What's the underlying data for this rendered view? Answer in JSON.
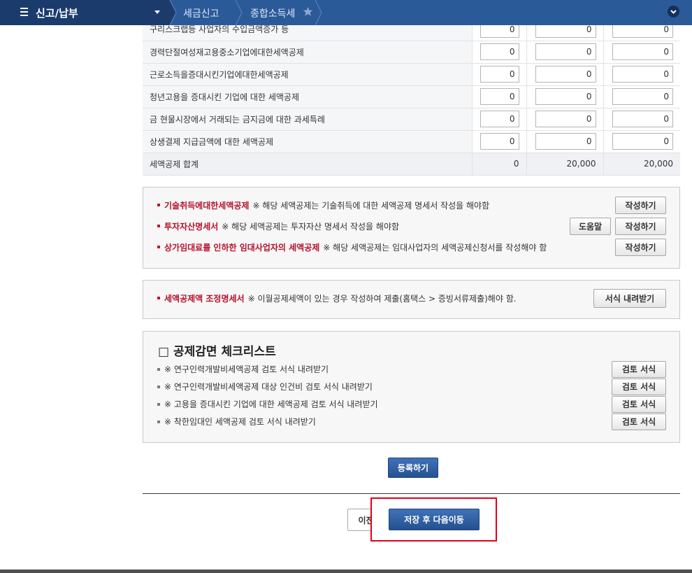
{
  "header": {
    "menu_label": "신고/납부",
    "breadcrumb": [
      "세금신고",
      "종합소득세"
    ]
  },
  "deduction_table": {
    "rows": [
      {
        "label": "구리스크랩등 사업자의 수입금액증가 등",
        "values": [
          "0",
          "0",
          "0"
        ]
      },
      {
        "label": "경력단절여성재고용중소기업에대한세액공제",
        "values": [
          "0",
          "0",
          "0"
        ]
      },
      {
        "label": "근로소득을증대시킨기업에대한세액공제",
        "values": [
          "0",
          "0",
          "0"
        ]
      },
      {
        "label": "청년고용을 증대시킨 기업에 대한 세액공제",
        "values": [
          "0",
          "0",
          "0"
        ]
      },
      {
        "label": "금 현물시장에서 거래되는 금지금에 대한 과세특례",
        "values": [
          "0",
          "0",
          "0"
        ]
      },
      {
        "label": "상생결제 지급금액에 대한 세액공제",
        "values": [
          "0",
          "0",
          "0"
        ]
      }
    ],
    "total": {
      "label": "세액공제 합계",
      "values": [
        "0",
        "20,000",
        "20,000"
      ]
    }
  },
  "required_forms": {
    "items": [
      {
        "title": "기술취득에대한세액공제",
        "note": "※ 해당 세액공제는 기술취득에 대한 세액공제 명세서 작성을 해야함",
        "buttons": [
          "작성하기"
        ]
      },
      {
        "title": "투자자산명세서",
        "note": "※ 해당 세액공제는 투자자산 명세서 작성을 해야함",
        "buttons": [
          "도움말",
          "작성하기"
        ]
      },
      {
        "title": "상가임대료를 인하한 임대사업자의 세액공제",
        "note": "※ 해당 세액공제는 임대사업자의 세액공제신청서를 작성해야 함",
        "buttons": [
          "작성하기"
        ]
      }
    ]
  },
  "adjustment": {
    "title": "세액공제액 조정명세서",
    "note": "※ 이월공제세액이 있는 경우 작성하여 제출(홈택스 > 증빙서류제출)해야 함.",
    "button": "서식 내려받기"
  },
  "checklist": {
    "title": "□ 공제감면 체크리스트",
    "items": [
      {
        "text": "※ 연구인력개발비세액공제 검토 서식 내려받기",
        "button": "검토 서식"
      },
      {
        "text": "※ 연구인력개발비세액공제 대상 인건비 검토 서식 내려받기",
        "button": "검토 서식"
      },
      {
        "text": "※ 고용을 증대시킨 기업에 대한 세액공제 검토 서식 내려받기",
        "button": "검토 서식"
      },
      {
        "text": "※ 착한임대인 세액공제 검토 서식 내려받기",
        "button": "검토 서식"
      }
    ]
  },
  "register_button": "등록하기",
  "footer_nav": {
    "prev_button": "이전",
    "save_next_button": "저장 후 다음이동"
  },
  "icons": {
    "menu": "menu-icon",
    "menu_dropdown": "dropdown-arrow-icon",
    "favorite": "star-icon",
    "expand": "chevron-down-circle-icon",
    "bullet": "square-bullet-icon"
  },
  "colors": {
    "header_bg": "#2b5a99",
    "header_menu_bg": "#1b3b6c",
    "accent_red": "#b5122b",
    "primary_button": "#2e5fa4",
    "highlight_annotation": "#e2001a"
  }
}
